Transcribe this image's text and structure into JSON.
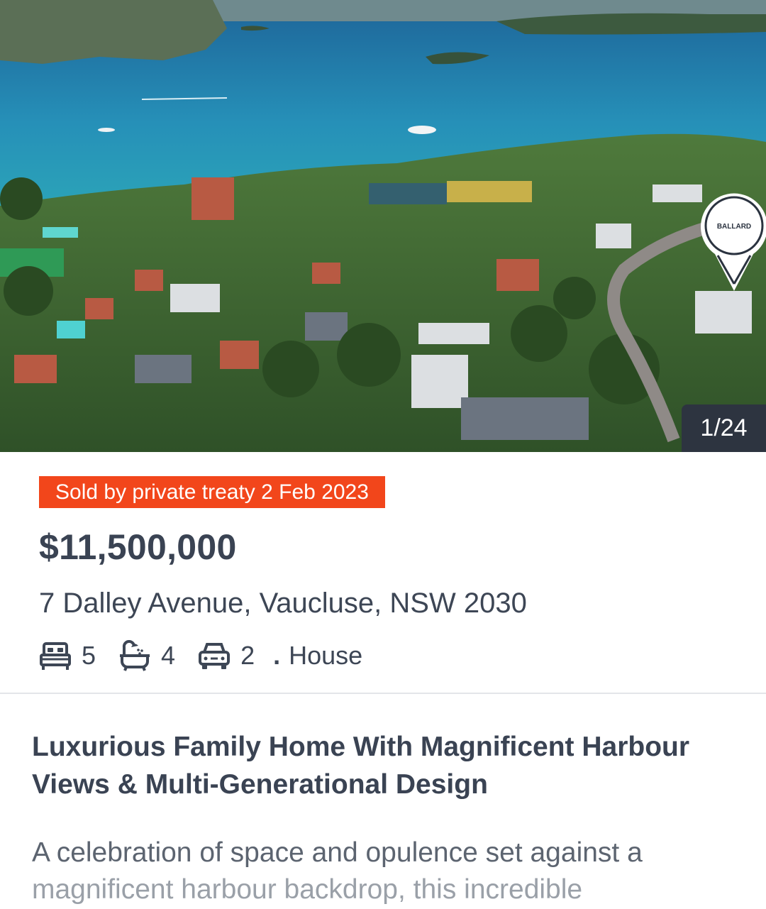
{
  "gallery": {
    "counter": "1/24",
    "agency_logo_text": "BALLARD"
  },
  "listing": {
    "status_badge": "Sold by private treaty 2 Feb 2023",
    "price": "$11,500,000",
    "address": "7 Dalley Avenue, Vaucluse, NSW 2030",
    "features": {
      "bedrooms": "5",
      "bathrooms": "4",
      "parking": "2",
      "separator": ".",
      "property_type": "House"
    },
    "headline": "Luxurious Family Home With Magnificent Harbour Views & Multi-Generational Design",
    "description_line1": "A celebration of space and opulence set against a",
    "description_line2": "magnificent harbour backdrop, this incredible"
  },
  "icons": {
    "bed": "bed-icon",
    "bath": "bath-icon",
    "car": "car-icon",
    "map_pin": "map-pin-icon"
  },
  "colors": {
    "badge": "#f2461b",
    "counter_bg": "#2d3440",
    "text": "#3d4655"
  }
}
